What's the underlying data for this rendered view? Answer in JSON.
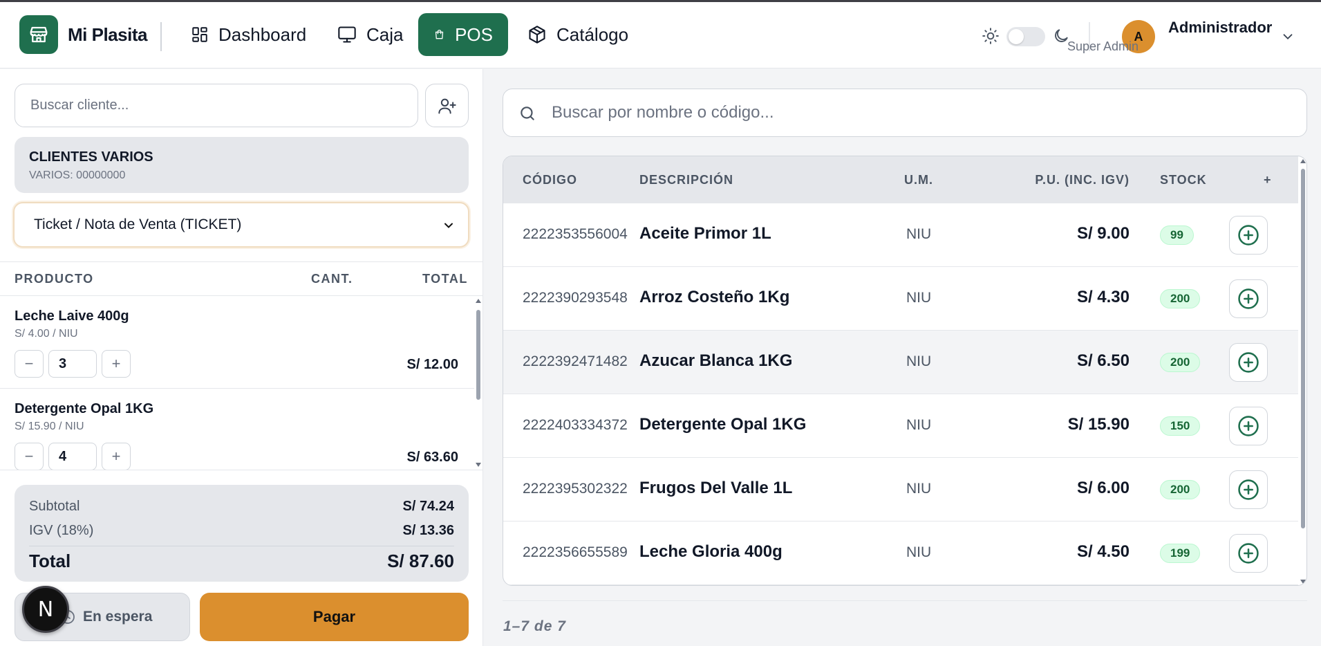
{
  "header": {
    "brand": "Mi Plasita",
    "nav": [
      {
        "label": "Dashboard",
        "icon": "layout-grid-icon"
      },
      {
        "label": "Caja",
        "icon": "monitor-icon"
      },
      {
        "label": "POS",
        "icon": "shopping-bag-icon",
        "active": true
      },
      {
        "label": "Catálogo",
        "icon": "package-icon"
      }
    ],
    "user": {
      "initial": "A",
      "name": "Administrador",
      "role": "Super Admin"
    }
  },
  "left": {
    "client_search_placeholder": "Buscar cliente...",
    "client": {
      "name": "CLIENTES VARIOS",
      "doc": "VARIOS: 00000000"
    },
    "doc_type": "Ticket / Nota de Venta (TICKET)",
    "cart_headers": {
      "product": "PRODUCTO",
      "qty": "CANT.",
      "total": "TOTAL"
    },
    "cart_items": [
      {
        "name": "Leche Laive 400g",
        "sub": "S/ 4.00 / NIU",
        "qty": "3",
        "total": "S/ 12.00"
      },
      {
        "name": "Detergente Opal 1KG",
        "sub": "S/ 15.90 / NIU",
        "qty": "4",
        "total": "S/ 63.60"
      }
    ],
    "summary": {
      "subtotal_label": "Subtotal",
      "subtotal": "S/ 74.24",
      "igv_label": "IGV (18%)",
      "igv": "S/ 13.36",
      "total_label": "Total",
      "total": "S/ 87.60"
    },
    "hold_label": "En espera",
    "pay_label": "Pagar",
    "badge": "N"
  },
  "right": {
    "search_placeholder": "Buscar por nombre o código...",
    "columns": {
      "code": "CÓDIGO",
      "desc": "DESCRIPCIÓN",
      "um": "U.M.",
      "price": "P.U. (INC. IGV)",
      "stock": "STOCK",
      "add": "+"
    },
    "rows": [
      {
        "code": "2222353556004",
        "desc": "Aceite Primor 1L",
        "um": "NIU",
        "price": "S/ 9.00",
        "stock": "99"
      },
      {
        "code": "2222390293548",
        "desc": "Arroz Costeño 1Kg",
        "um": "NIU",
        "price": "S/ 4.30",
        "stock": "200"
      },
      {
        "code": "2222392471482",
        "desc": "Azucar Blanca 1KG",
        "um": "NIU",
        "price": "S/ 6.50",
        "stock": "200"
      },
      {
        "code": "2222403334372",
        "desc": "Detergente Opal 1KG",
        "um": "NIU",
        "price": "S/ 15.90",
        "stock": "150"
      },
      {
        "code": "2222395302322",
        "desc": "Frugos Del Valle 1L",
        "um": "NIU",
        "price": "S/ 6.00",
        "stock": "200"
      },
      {
        "code": "2222356655589",
        "desc": "Leche Gloria 400g",
        "um": "NIU",
        "price": "S/ 4.50",
        "stock": "199"
      }
    ],
    "pagination": "1–7 de 7"
  },
  "colors": {
    "primary": "#1f6f4e",
    "accent": "#db8f2e",
    "stock_badge": "#dcfce7"
  }
}
